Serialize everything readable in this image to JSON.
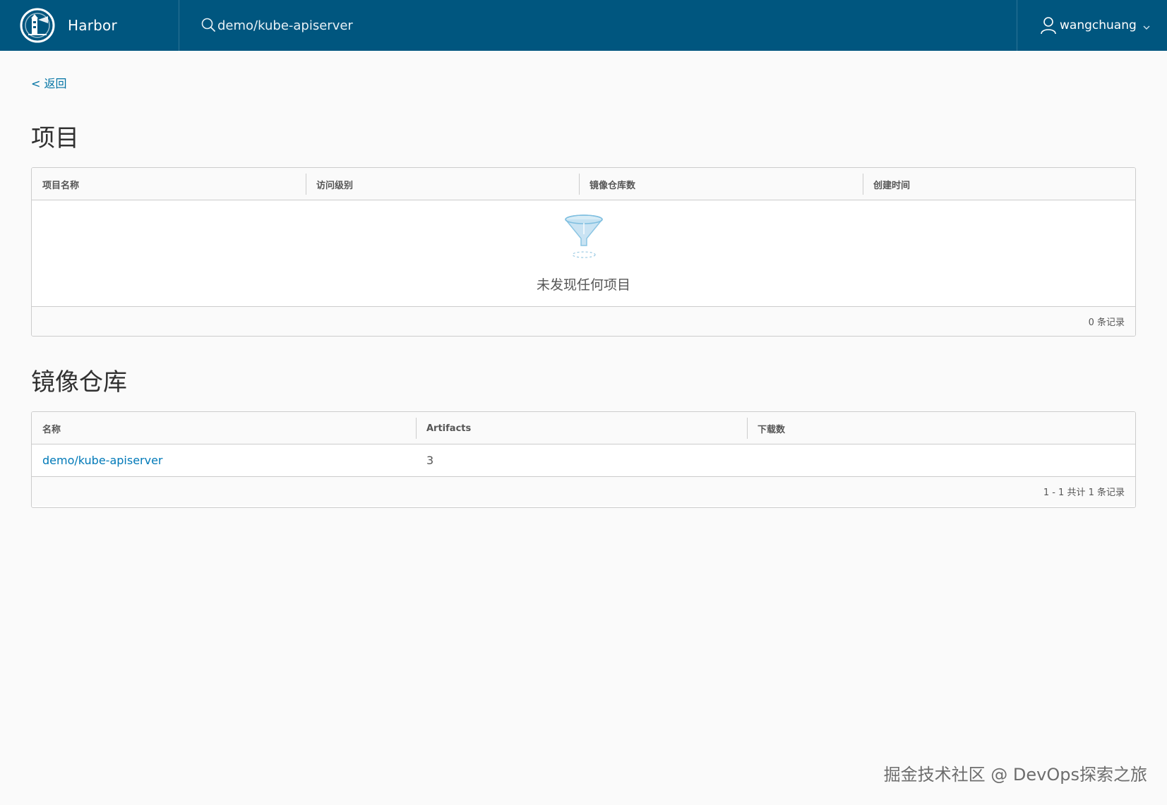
{
  "header": {
    "brand_name": "Harbor",
    "search_value": "demo/kube-apiserver",
    "user_name": "wangchuang",
    "background_color": "#00567f"
  },
  "nav": {
    "back_label": "< 返回"
  },
  "projects_section": {
    "title": "项目",
    "columns": [
      "项目名称",
      "访问级别",
      "镜像仓库数",
      "创建时间"
    ],
    "empty_icon": "filter-funnel-icon",
    "empty_message": "未发现任何项目",
    "footer": "0 条记录"
  },
  "repositories_section": {
    "title": "镜像仓库",
    "columns": [
      "名称",
      "Artifacts",
      "下载数"
    ],
    "rows": [
      {
        "name": "demo/kube-apiserver",
        "artifacts": "3",
        "downloads": ""
      }
    ],
    "footer": "1 - 1 共计 1 条记录"
  },
  "watermark": "掘金技术社区 @ DevOps探索之旅",
  "colors": {
    "link": "#0079b8",
    "border": "#cccccc"
  }
}
